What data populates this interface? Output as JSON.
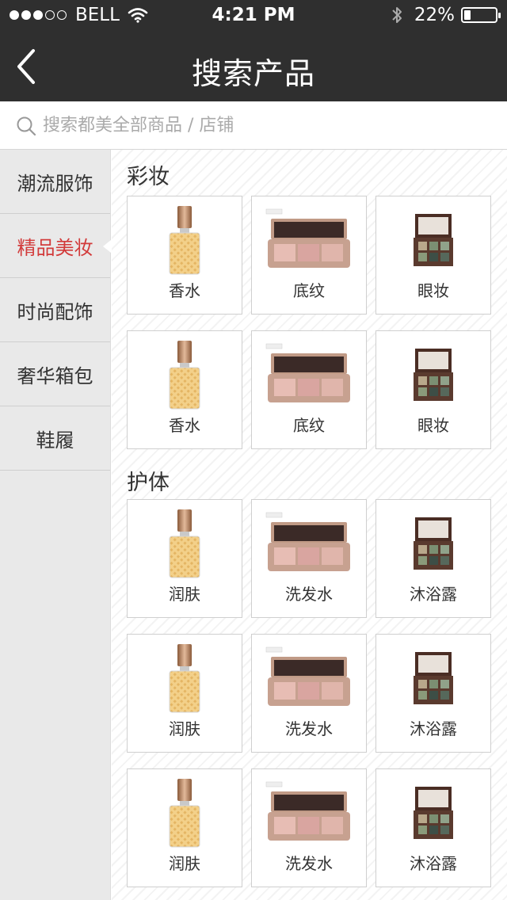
{
  "status_bar": {
    "carrier": "BELL",
    "time": "4:21 PM",
    "battery": "22%",
    "battery_level": 0.22,
    "signal_dots_filled": 3,
    "signal_dots_total": 5,
    "icons": [
      "wifi-icon",
      "bluetooth-icon",
      "battery-icon"
    ]
  },
  "nav": {
    "title": "搜索产品",
    "back_icon": "chevron-left-icon"
  },
  "search": {
    "placeholder": "搜索都美全部商品 / 店铺",
    "value": "",
    "icon": "search-icon"
  },
  "sidebar": {
    "items": [
      {
        "label": "潮流服饰",
        "active": false
      },
      {
        "label": "精品美妆",
        "active": true
      },
      {
        "label": "时尚配饰",
        "active": false
      },
      {
        "label": "奢华箱包",
        "active": false
      },
      {
        "label": "鞋履",
        "active": false
      }
    ]
  },
  "colors": {
    "topbar": "#2f2f2f",
    "accent": "#d23b3b",
    "sidebar_bg": "#e9e9e9"
  },
  "sections": [
    {
      "title": "彩妆",
      "rows": [
        [
          {
            "label": "香水",
            "icon": "perfume-bottle-icon"
          },
          {
            "label": "底纹",
            "icon": "highlighter-palette-icon"
          },
          {
            "label": "眼妆",
            "icon": "eyeshadow-palette-icon"
          }
        ],
        [
          {
            "label": "香水",
            "icon": "perfume-bottle-icon"
          },
          {
            "label": "底纹",
            "icon": "highlighter-palette-icon"
          },
          {
            "label": "眼妆",
            "icon": "eyeshadow-palette-icon"
          }
        ]
      ]
    },
    {
      "title": "护体",
      "rows": [
        [
          {
            "label": "润肤",
            "icon": "perfume-bottle-icon"
          },
          {
            "label": "洗发水",
            "icon": "highlighter-palette-icon"
          },
          {
            "label": "沐浴露",
            "icon": "eyeshadow-palette-icon"
          }
        ],
        [
          {
            "label": "润肤",
            "icon": "perfume-bottle-icon"
          },
          {
            "label": "洗发水",
            "icon": "highlighter-palette-icon"
          },
          {
            "label": "沐浴露",
            "icon": "eyeshadow-palette-icon"
          }
        ],
        [
          {
            "label": "润肤",
            "icon": "perfume-bottle-icon"
          },
          {
            "label": "洗发水",
            "icon": "highlighter-palette-icon"
          },
          {
            "label": "沐浴露",
            "icon": "eyeshadow-palette-icon"
          }
        ]
      ]
    }
  ]
}
